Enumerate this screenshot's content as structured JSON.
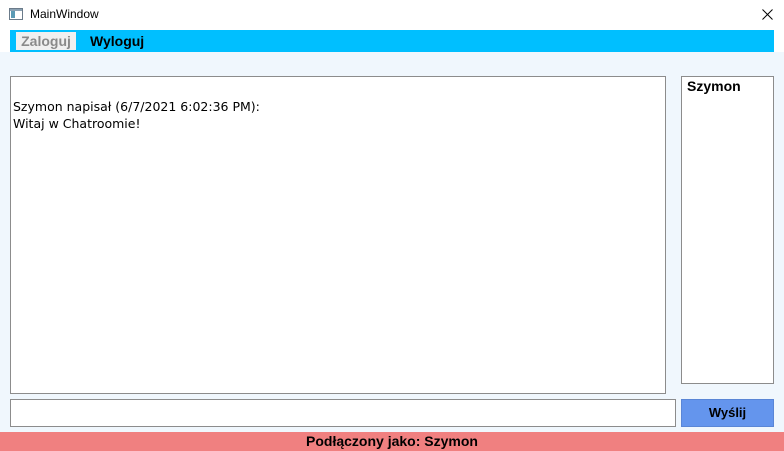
{
  "window": {
    "title": "MainWindow",
    "icon": "app-window-icon",
    "close_icon": "close-icon"
  },
  "menu": {
    "login_label": "Zaloguj",
    "logout_label": "Wyloguj",
    "login_enabled": false
  },
  "chat": {
    "messages": [
      {
        "header": "Szymon napisał (6/7/2021 6:02:36 PM):",
        "text": "Witaj w Chatroomie!"
      }
    ]
  },
  "users": {
    "items": [
      "Szymon"
    ]
  },
  "composer": {
    "input_value": "",
    "send_label": "Wyślij"
  },
  "status": {
    "text": "Podłączony jako: Szymon"
  },
  "colors": {
    "menubar": "#00bfff",
    "send_button": "#6495ed",
    "statusbar": "#f08080",
    "workspace": "#f0f7fd"
  }
}
